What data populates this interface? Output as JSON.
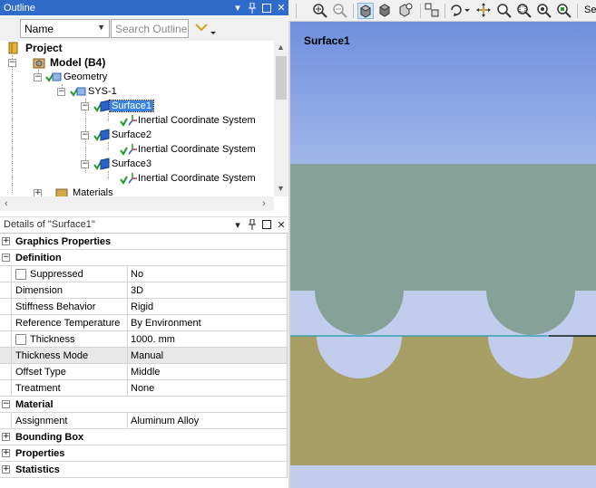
{
  "outline": {
    "title": "Outline",
    "filter_select": "Name",
    "search_placeholder": "Search Outline",
    "tree": {
      "project": "Project",
      "model": "Model (B4)",
      "geometry": "Geometry",
      "sys": "SYS-1",
      "surface1": "Surface1",
      "surface2": "Surface2",
      "surface3": "Surface3",
      "ics": "Inertial Coordinate System",
      "materials": "Materials"
    }
  },
  "details": {
    "title": "Details of \"Surface1\"",
    "groups": {
      "graphics": "Graphics Properties",
      "definition": "Definition",
      "material": "Material",
      "bounding_box": "Bounding Box",
      "properties": "Properties",
      "statistics": "Statistics"
    },
    "rows": {
      "suppressed": {
        "name": "Suppressed",
        "value": "No"
      },
      "dimension": {
        "name": "Dimension",
        "value": "3D"
      },
      "stiffness": {
        "name": "Stiffness Behavior",
        "value": "Rigid"
      },
      "reftemp": {
        "name": "Reference Temperature",
        "value": "By Environment"
      },
      "thickness": {
        "name": "Thickness",
        "value": "1000. mm"
      },
      "thickmode": {
        "name": "Thickness Mode",
        "value": "Manual"
      },
      "offset": {
        "name": "Offset Type",
        "value": "Middle"
      },
      "treatment": {
        "name": "Treatment",
        "value": "None"
      },
      "assignment": {
        "name": "Assignment",
        "value": "Aluminum Alloy"
      }
    }
  },
  "toolbar": {
    "more_label": "Se"
  },
  "viewport": {
    "title": "Surface1",
    "colors": {
      "sky_top": "#7090de",
      "sky_bottom": "#a0b6e8",
      "upper_body": "#86a298",
      "lower_body": "#a89f67",
      "light_band": "#c2cdee",
      "interface_line": "#1f9aa6"
    }
  }
}
